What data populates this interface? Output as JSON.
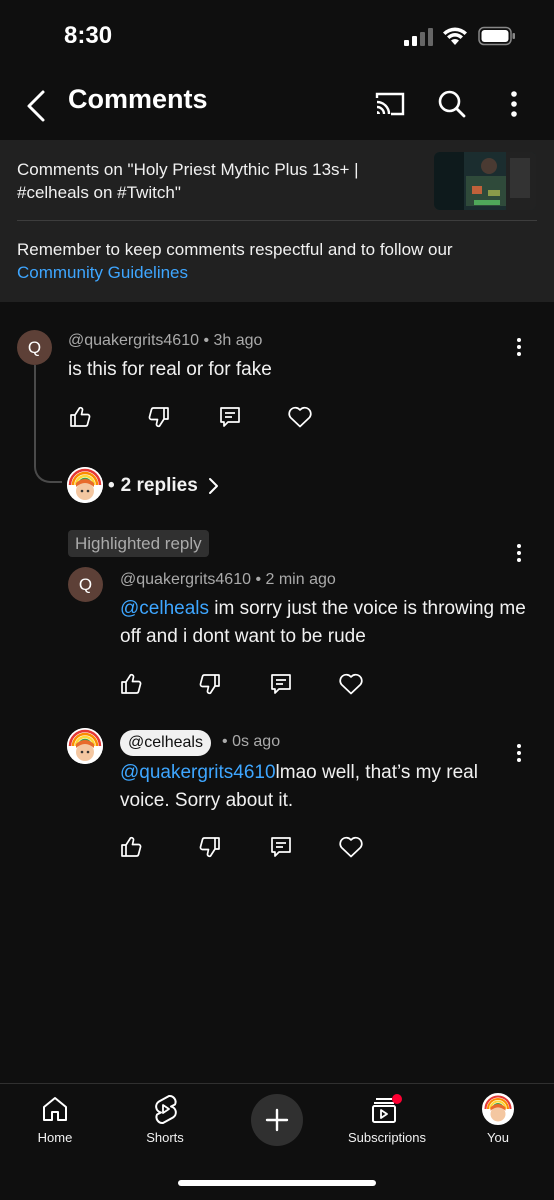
{
  "status": {
    "time": "8:30"
  },
  "app_bar": {
    "title": "Comments"
  },
  "header": {
    "video_info": "Comments on \"Holy Priest Mythic Plus 13s+ | #celheals on #Twitch\"",
    "reminder": "Remember to keep comments respectful and to follow our",
    "guidelines_link": "Community Guidelines"
  },
  "comment": {
    "avatar_letter": "Q",
    "author": "@quakergrits4610",
    "time": "3h ago",
    "text": "is this for real or for fake",
    "replies_label": "2 replies"
  },
  "highlighted_reply": {
    "badge": "Highlighted reply",
    "avatar_letter": "Q",
    "author": "@quakergrits4610",
    "time": "2 min ago",
    "mention": "@celheals",
    "text": " im sorry just the voice is throwing me off and i dont want to be rude"
  },
  "creator_reply": {
    "author": "@celheals",
    "time": "0s ago",
    "mention": "@quakergrits4610",
    "text": "lmao well, that’s my real voice. Sorry about it."
  },
  "separator": "•",
  "bottom_nav": {
    "home": "Home",
    "shorts": "Shorts",
    "subscriptions": "Subscriptions",
    "you": "You"
  },
  "colors": {
    "link": "#3ea6ff",
    "notification_dot": "#ff0033"
  },
  "icons": [
    "back-arrow-icon",
    "cast-icon",
    "search-icon",
    "more-vert-icon",
    "thumbs-up-icon",
    "thumbs-down-icon",
    "reply-icon",
    "heart-icon",
    "home-icon",
    "shorts-icon",
    "plus-icon",
    "subscriptions-icon"
  ]
}
